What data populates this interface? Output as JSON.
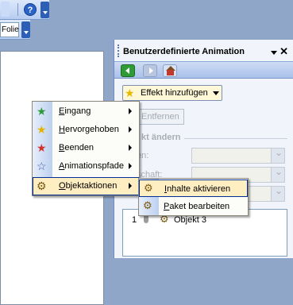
{
  "toolbar": {
    "help_icon_glyph": "?",
    "slide_field_value": "Folie"
  },
  "task_pane": {
    "title": "Benutzerdefinierte Animation",
    "nav": [
      "back-icon",
      "forward-icon",
      "home-icon"
    ],
    "add_effect_label": "Effekt hinzufügen",
    "remove_label": "Entfernen",
    "section_label": "kt ändern",
    "fields": [
      {
        "label": "en:"
      },
      {
        "label": "schaft:"
      },
      {
        "label": ""
      }
    ],
    "list": [
      {
        "number": "1",
        "text": "Objekt 3"
      }
    ]
  },
  "context_menu": {
    "items": [
      {
        "label": "Eingang",
        "icon": "green-star-icon",
        "has_submenu": true
      },
      {
        "label": "Hervorgehoben",
        "icon": "yellow-star-icon",
        "has_submenu": true
      },
      {
        "label": "Beenden",
        "icon": "red-star-icon",
        "has_submenu": true
      },
      {
        "label": "Animationspfade",
        "icon": "outline-star-icon",
        "has_submenu": true
      },
      {
        "label": "Objektaktionen",
        "icon": "gears-icon",
        "has_submenu": true,
        "selected": true
      }
    ]
  },
  "submenu": {
    "items": [
      {
        "label": "Inhalte aktivieren",
        "icon": "gears-icon",
        "selected": true
      },
      {
        "label": "Paket bearbeiten",
        "icon": "gears-icon",
        "selected": false
      }
    ]
  },
  "colors": {
    "menu_highlight": "#ffeec2",
    "highlight_border": "#002d96",
    "pane_background": "#f1f4fb"
  }
}
